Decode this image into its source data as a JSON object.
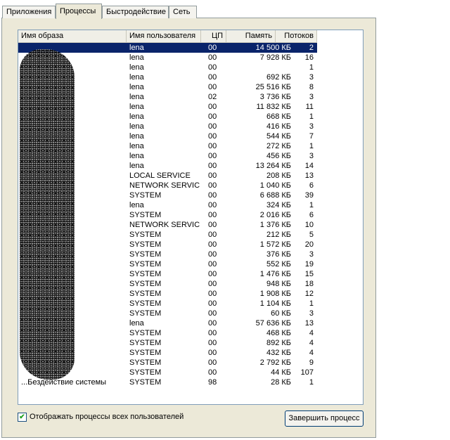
{
  "tabs": [
    {
      "label": "Приложения",
      "active": false
    },
    {
      "label": "Процессы",
      "active": true
    },
    {
      "label": "Быстродействие",
      "active": false
    },
    {
      "label": "Сеть",
      "active": false
    }
  ],
  "columns": [
    "Имя образа",
    "Имя пользователя",
    "ЦП",
    "Память",
    "Потоков"
  ],
  "rows": [
    {
      "name": "",
      "user": "lena",
      "cpu": "00",
      "mem": "14 500 КБ",
      "threads": "2",
      "selected": true
    },
    {
      "name": "",
      "user": "lena",
      "cpu": "00",
      "mem": "7 928 КБ",
      "threads": "16"
    },
    {
      "name": "",
      "user": "lena",
      "cpu": "00",
      "mem": "",
      "threads": "1"
    },
    {
      "name": "",
      "user": "lena",
      "cpu": "00",
      "mem": "692 КБ",
      "threads": "3"
    },
    {
      "name": "",
      "user": "lena",
      "cpu": "00",
      "mem": "25 516 КБ",
      "threads": "8"
    },
    {
      "name": "",
      "user": "lena",
      "cpu": "02",
      "mem": "3 736 КБ",
      "threads": "3"
    },
    {
      "name": "",
      "user": "lena",
      "cpu": "00",
      "mem": "11 832 КБ",
      "threads": "11"
    },
    {
      "name": "",
      "user": "lena",
      "cpu": "00",
      "mem": "668 КБ",
      "threads": "1"
    },
    {
      "name": "",
      "user": "lena",
      "cpu": "00",
      "mem": "416 КБ",
      "threads": "3"
    },
    {
      "name": "",
      "user": "lena",
      "cpu": "00",
      "mem": "544 КБ",
      "threads": "7"
    },
    {
      "name": "",
      "user": "lena",
      "cpu": "00",
      "mem": "272 КБ",
      "threads": "1"
    },
    {
      "name": "",
      "user": "lena",
      "cpu": "00",
      "mem": "456 КБ",
      "threads": "3"
    },
    {
      "name": "",
      "user": "lena",
      "cpu": "00",
      "mem": "13 264 КБ",
      "threads": "14"
    },
    {
      "name": "",
      "user": "LOCAL SERVICE",
      "cpu": "00",
      "mem": "208 КБ",
      "threads": "13"
    },
    {
      "name": "",
      "user": "NETWORK SERVICE",
      "cpu": "00",
      "mem": "1 040 КБ",
      "threads": "6"
    },
    {
      "name": "",
      "user": "SYSTEM",
      "cpu": "00",
      "mem": "6 688 КБ",
      "threads": "39"
    },
    {
      "name": "",
      "user": "lena",
      "cpu": "00",
      "mem": "324 КБ",
      "threads": "1"
    },
    {
      "name": "",
      "user": "SYSTEM",
      "cpu": "00",
      "mem": "2 016 КБ",
      "threads": "6"
    },
    {
      "name": "",
      "user": "NETWORK SERVICE",
      "cpu": "00",
      "mem": "1 376 КБ",
      "threads": "10"
    },
    {
      "name": "",
      "user": "SYSTEM",
      "cpu": "00",
      "mem": "212 КБ",
      "threads": "5"
    },
    {
      "name": "",
      "user": "SYSTEM",
      "cpu": "00",
      "mem": "1 572 КБ",
      "threads": "20"
    },
    {
      "name": "",
      "user": "SYSTEM",
      "cpu": "00",
      "mem": "376 КБ",
      "threads": "3"
    },
    {
      "name": "",
      "user": "SYSTEM",
      "cpu": "00",
      "mem": "552 КБ",
      "threads": "19"
    },
    {
      "name": "",
      "user": "SYSTEM",
      "cpu": "00",
      "mem": "1 476 КБ",
      "threads": "15"
    },
    {
      "name": "",
      "user": "SYSTEM",
      "cpu": "00",
      "mem": "948 КБ",
      "threads": "18"
    },
    {
      "name": "",
      "user": "SYSTEM",
      "cpu": "00",
      "mem": "1 908 КБ",
      "threads": "12"
    },
    {
      "name": "",
      "user": "SYSTEM",
      "cpu": "00",
      "mem": "1 104 КБ",
      "threads": "1"
    },
    {
      "name": "",
      "user": "SYSTEM",
      "cpu": "00",
      "mem": "60 КБ",
      "threads": "3"
    },
    {
      "name": "",
      "user": "lena",
      "cpu": "00",
      "mem": "57 636 КБ",
      "threads": "13"
    },
    {
      "name": "",
      "user": "SYSTEM",
      "cpu": "00",
      "mem": "468 КБ",
      "threads": "4"
    },
    {
      "name": "",
      "user": "SYSTEM",
      "cpu": "00",
      "mem": "892 КБ",
      "threads": "4"
    },
    {
      "name": "",
      "user": "SYSTEM",
      "cpu": "00",
      "mem": "432 КБ",
      "threads": "4"
    },
    {
      "name": "",
      "user": "SYSTEM",
      "cpu": "00",
      "mem": "2 792 КБ",
      "threads": "9"
    },
    {
      "name": "",
      "user": "SYSTEM",
      "cpu": "00",
      "mem": "44 КБ",
      "threads": "107"
    },
    {
      "name": "...Бездействие системы",
      "user": "SYSTEM",
      "cpu": "98",
      "mem": "28 КБ",
      "threads": "1"
    }
  ],
  "show_all_checkbox": {
    "label": "Отображать процессы всех пользователей",
    "checked": true
  },
  "end_process_button": "Завершить процесс"
}
